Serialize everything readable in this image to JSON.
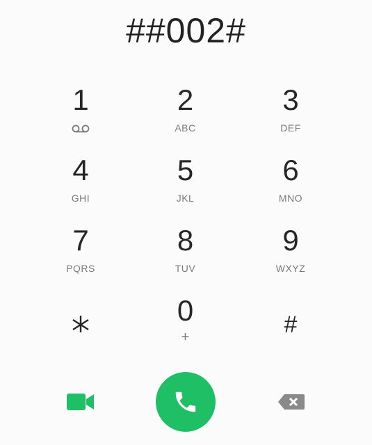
{
  "dialer": {
    "number": "##002#"
  },
  "keypad": {
    "keys": [
      {
        "digit": "1",
        "letters": "",
        "sub_icon": "voicemail-icon"
      },
      {
        "digit": "2",
        "letters": "ABC"
      },
      {
        "digit": "3",
        "letters": "DEF"
      },
      {
        "digit": "4",
        "letters": "GHI"
      },
      {
        "digit": "5",
        "letters": "JKL"
      },
      {
        "digit": "6",
        "letters": "MNO"
      },
      {
        "digit": "7",
        "letters": "PQRS"
      },
      {
        "digit": "8",
        "letters": "TUV"
      },
      {
        "digit": "9",
        "letters": "WXYZ"
      },
      {
        "digit": "*",
        "letters": "",
        "icon": "asterisk-icon"
      },
      {
        "digit": "0",
        "letters": "+"
      },
      {
        "digit": "#",
        "letters": ""
      }
    ]
  },
  "actions": {
    "video_call_icon": "video-camera-icon",
    "call_icon": "phone-handset-icon",
    "backspace_icon": "backspace-icon"
  },
  "colors": {
    "accent_green": "#1fbf66",
    "digit_text": "#262626",
    "letters_text": "#7a7a7a",
    "backspace_gray": "#8a8a8a",
    "background": "#fbfbfb"
  }
}
